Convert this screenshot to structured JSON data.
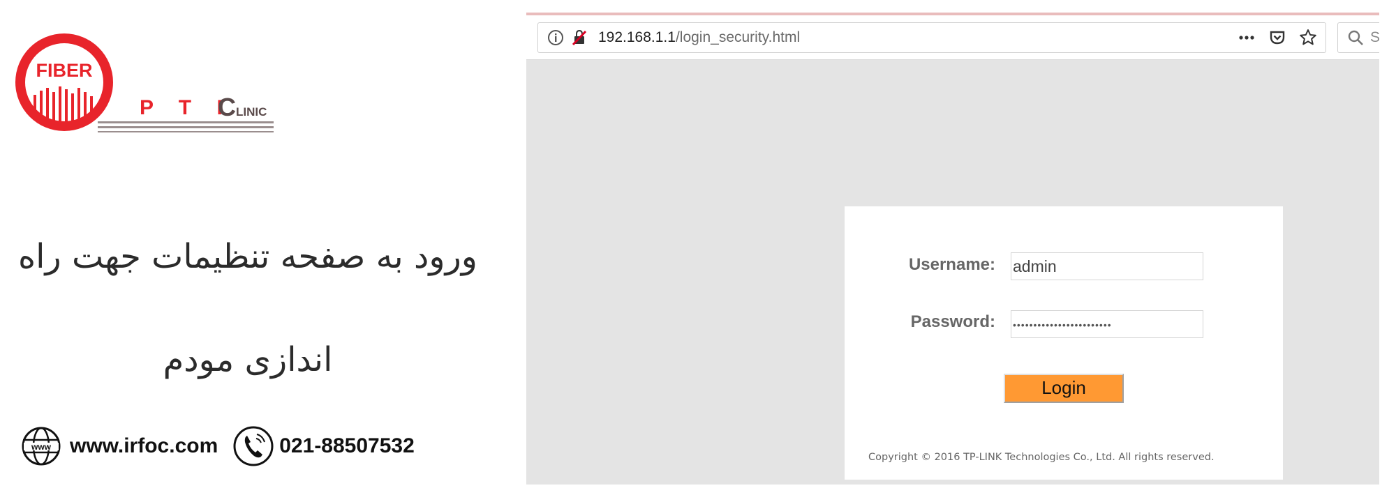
{
  "promo": {
    "logo": {
      "circle_text": "FIBER",
      "side_text": "P T I",
      "brand_initial": "C",
      "brand_rest": "LINIC",
      "color": "#e8242b",
      "stripe_color": "#9a8e8e"
    },
    "headline_line1": "ورود به صفحه تنظیمات جهت راه",
    "headline_line2": "اندازی مودم",
    "website": "www.irfoc.com",
    "phone": "021-88507532",
    "icons": {
      "globe": "globe-icon",
      "phone": "phone-icon"
    }
  },
  "browser": {
    "url_host": "192.168.1.1",
    "url_path": "/login_security.html",
    "search_placeholder": "S",
    "icons": [
      "info-icon",
      "insecure-connection-icon",
      "more-icon",
      "pocket-icon",
      "bookmark-star-icon",
      "search-icon"
    ]
  },
  "login": {
    "username_label": "Username:",
    "username_value": "admin",
    "password_label": "Password:",
    "password_value": "••••••••••••••••••••••••",
    "button_label": "Login",
    "button_color": "#ff9933",
    "copyright": "Copyright © 2016 TP-LINK Technologies Co., Ltd. All rights reserved."
  }
}
